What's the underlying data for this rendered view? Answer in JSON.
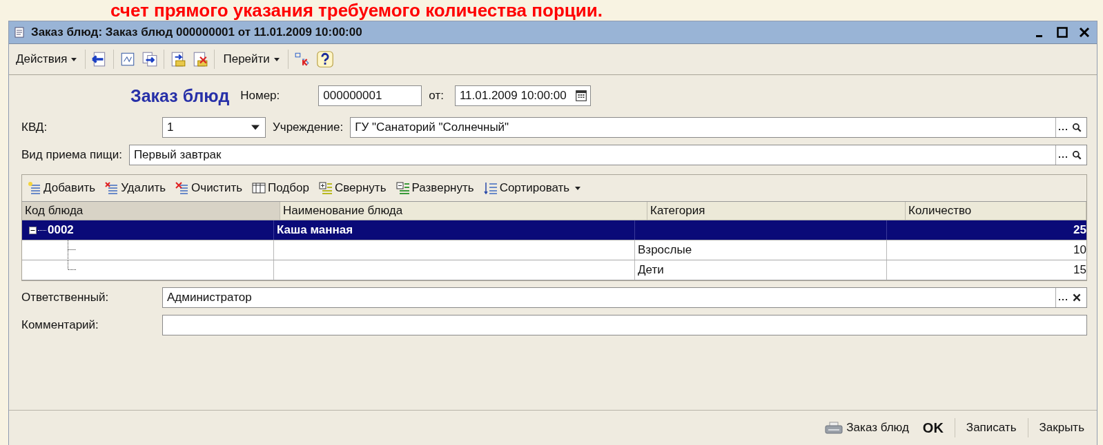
{
  "slide_caption": "счет прямого указания требуемого количества порции.",
  "window": {
    "title": "Заказ блюд: Заказ блюд 000000001 от 11.01.2009 10:00:00"
  },
  "toolbar": {
    "actions_menu": "Действия",
    "goto_menu": "Перейти"
  },
  "header": {
    "heading": "Заказ блюд",
    "number_label": "Номер:",
    "number": "000000001",
    "date_label": "от:",
    "date": "11.01.2009 10:00:00"
  },
  "fields": {
    "kvd_label": "КВД:",
    "kvd": "1",
    "institution_label": "Учреждение:",
    "institution": "ГУ \"Санаторий \"Солнечный\"",
    "meal_label": "Вид приема пищи:",
    "meal": "Первый завтрак"
  },
  "table_toolbar": [
    {
      "kind": "add",
      "label": "Добавить"
    },
    {
      "kind": "delete",
      "label": "Удалить"
    },
    {
      "kind": "clear",
      "label": "Очистить"
    },
    {
      "kind": "pick",
      "label": "Подбор"
    },
    {
      "kind": "collapse",
      "label": "Свернуть"
    },
    {
      "kind": "expand",
      "label": "Развернуть"
    },
    {
      "kind": "sort",
      "label": "Сортировать"
    }
  ],
  "table": {
    "columns": [
      "Код блюда",
      "Наименование блюда",
      "Категория",
      "Количество"
    ],
    "rows": [
      {
        "code": "0002",
        "name": "Каша манная",
        "quantity": "25",
        "selected": true,
        "expanded": true,
        "children": [
          {
            "category": "Взрослые",
            "quantity": "10",
            "selected": false
          },
          {
            "category": "Дети",
            "quantity": "15",
            "selected": false
          }
        ]
      }
    ]
  },
  "footer_fields": {
    "responsible_label": "Ответственный:",
    "responsible": "Администратор",
    "comment_label": "Комментарий:"
  },
  "bottom_bar": {
    "print_label": "Заказ блюд",
    "buttons": [
      {
        "label": "OK",
        "default": true
      },
      {
        "label": "Записать",
        "default": false
      },
      {
        "label": "Закрыть",
        "default": false
      }
    ]
  }
}
